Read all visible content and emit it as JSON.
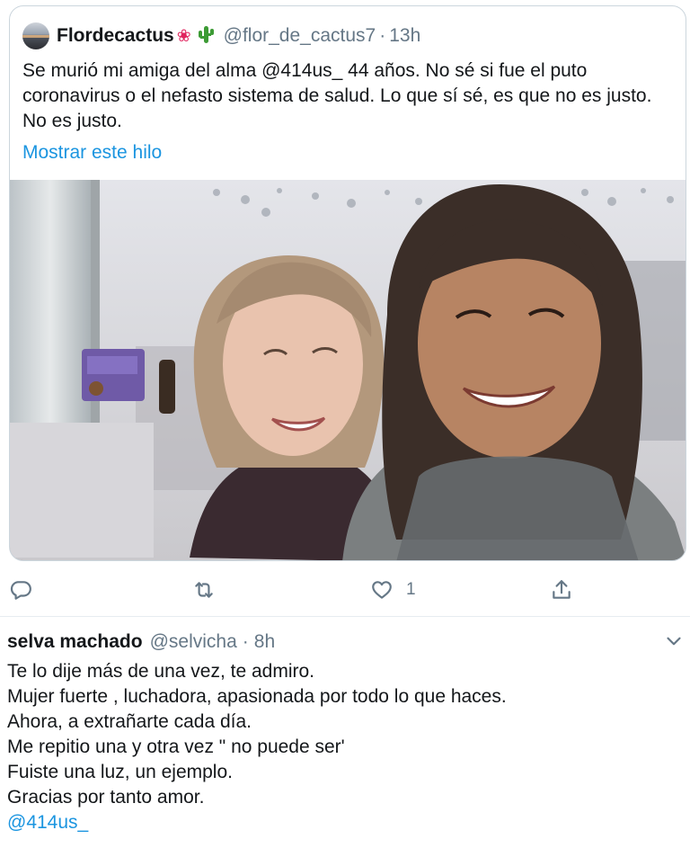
{
  "quoted_tweet": {
    "author_name": "Flordecactus",
    "emoji_flower": "❀",
    "emoji_cactus": "🌵",
    "handle": "@flor_de_cactus7",
    "separator": "·",
    "time": "13h",
    "text": "Se murió mi amiga del alma @414us_ 44 años. No sé si fue el puto coronavirus o el nefasto sistema de salud. Lo que sí sé, es que no es justo. No es justo.",
    "show_thread": "Mostrar este hilo",
    "image_icon": "selfie-photo"
  },
  "actions": {
    "reply_icon": "reply-icon",
    "retweet_icon": "retweet-icon",
    "like_icon": "like-icon",
    "like_count": "1",
    "share_icon": "share-icon"
  },
  "reply": {
    "author_name": "selva machado",
    "handle": "@selvicha",
    "separator": "·",
    "time": "8h",
    "menu_icon": "chevron-down-icon",
    "lines": [
      "Te lo dije más de una vez, te admiro.",
      "Mujer fuerte , luchadora, apasionada por todo lo que haces.",
      "Ahora, a extrañarte cada día.",
      "Me repitio una y otra vez \" no puede ser'",
      "Fuiste una luz, un ejemplo.",
      "Gracias por tanto amor."
    ],
    "mention": "@414us_"
  },
  "colors": {
    "link": "#1b95e0",
    "secondary_text": "#657786",
    "border": "#ccd6dd"
  }
}
